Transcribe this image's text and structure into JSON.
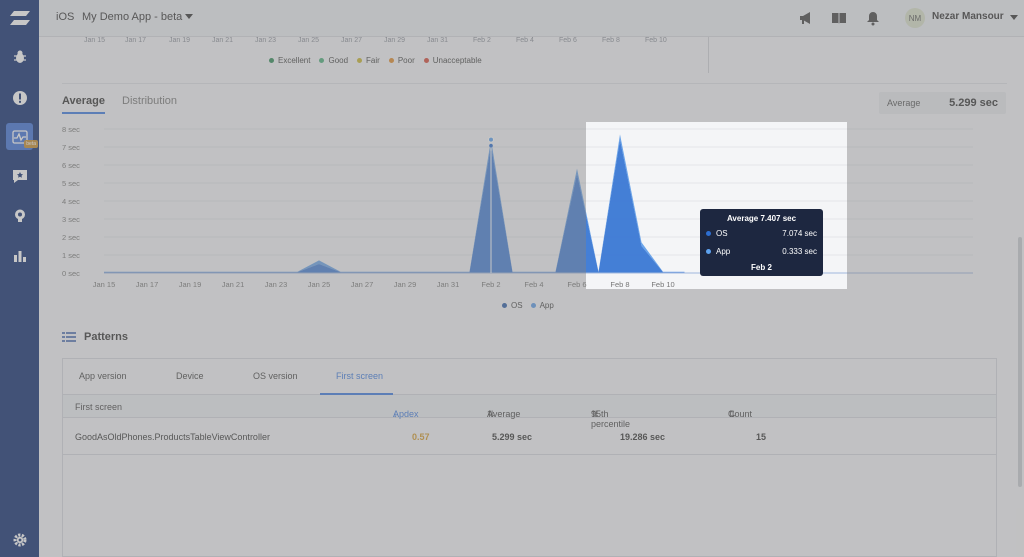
{
  "app": {
    "platform": "iOS",
    "name": "My Demo App - beta",
    "sidebar_badge": "beta"
  },
  "user": {
    "initials": "NM",
    "name": "Nezar Mansour"
  },
  "top_chart": {
    "tick_labels": [
      "Jan 15",
      "Jan 17",
      "Jan 19",
      "Jan 21",
      "Jan 23",
      "Jan 25",
      "Jan 27",
      "Jan 29",
      "Jan 31",
      "Feb 2",
      "Feb 4",
      "Feb 6",
      "Feb 8",
      "Feb 10"
    ],
    "legend": [
      {
        "label": "Excellent",
        "color": "#2e8b57"
      },
      {
        "label": "Good",
        "color": "#4caf7a"
      },
      {
        "label": "Fair",
        "color": "#c9b52e"
      },
      {
        "label": "Poor",
        "color": "#e08a2a"
      },
      {
        "label": "Unacceptable",
        "color": "#d64a3a"
      }
    ]
  },
  "tabs": {
    "average": "Average",
    "distribution": "Distribution"
  },
  "summary": {
    "label": "Average",
    "value": "5.299 sec"
  },
  "chart_data": {
    "type": "area",
    "x": [
      "Jan 15",
      "Jan 16",
      "Jan 17",
      "Jan 18",
      "Jan 19",
      "Jan 20",
      "Jan 21",
      "Jan 22",
      "Jan 23",
      "Jan 24",
      "Jan 25",
      "Jan 26",
      "Jan 27",
      "Jan 28",
      "Jan 29",
      "Jan 30",
      "Jan 31",
      "Feb 1",
      "Feb 2",
      "Feb 3",
      "Feb 4",
      "Feb 5",
      "Feb 6",
      "Feb 7",
      "Feb 8",
      "Feb 9",
      "Feb 10",
      "Feb 11"
    ],
    "x_tick_labels": [
      "Jan 15",
      "Jan 17",
      "Jan 19",
      "Jan 21",
      "Jan 23",
      "Jan 25",
      "Jan 27",
      "Jan 29",
      "Jan 31",
      "Feb 2",
      "Feb 4",
      "Feb 6",
      "Feb 8",
      "Feb 10"
    ],
    "y_tick_labels": [
      "0 sec",
      "1 sec",
      "2 sec",
      "3 sec",
      "4 sec",
      "5 sec",
      "6 sec",
      "7 sec",
      "8 sec"
    ],
    "ylim": [
      0,
      8
    ],
    "series": [
      {
        "name": "OS",
        "color": "#2d5ea8",
        "values": [
          0.05,
          0.05,
          0.05,
          0.05,
          0.05,
          0.05,
          0.05,
          0.05,
          0.05,
          0.05,
          0.5,
          0.05,
          0.05,
          0.05,
          0.05,
          0.05,
          0.05,
          0.05,
          7.074,
          0.05,
          0.05,
          0.05,
          5.5,
          0.05,
          7.4,
          1.5,
          0.05,
          0.05
        ]
      },
      {
        "name": "App",
        "color": "#5b9be8",
        "values": [
          0.02,
          0.02,
          0.02,
          0.02,
          0.02,
          0.02,
          0.02,
          0.02,
          0.02,
          0.02,
          0.2,
          0.02,
          0.02,
          0.02,
          0.02,
          0.02,
          0.02,
          0.02,
          0.333,
          0.02,
          0.02,
          0.02,
          0.3,
          0.02,
          0.3,
          0.2,
          0.02,
          0.02
        ]
      }
    ],
    "highlight_index": 18,
    "tooltip": {
      "title": "Average 7.407 sec",
      "rows": [
        {
          "label": "OS",
          "value": "7.074 sec",
          "color": "#2d6ed0"
        },
        {
          "label": "App",
          "value": "0.333 sec",
          "color": "#5ea3f0"
        }
      ],
      "date": "Feb 2"
    },
    "legend": [
      "OS",
      "App"
    ]
  },
  "patterns": {
    "title": "Patterns",
    "tabs": [
      "App version",
      "Device",
      "OS version",
      "First screen"
    ],
    "active_tab": "First screen",
    "columns": {
      "name": "First screen",
      "apdex": "Apdex",
      "average": "Average",
      "p95": "95th percentile",
      "count": "Count"
    },
    "rows": [
      {
        "name": "GoodAsOldPhones.ProductsTableViewController",
        "apdex": "0.57",
        "average": "5.299 sec",
        "p95": "19.286 sec",
        "count": "15"
      }
    ]
  }
}
